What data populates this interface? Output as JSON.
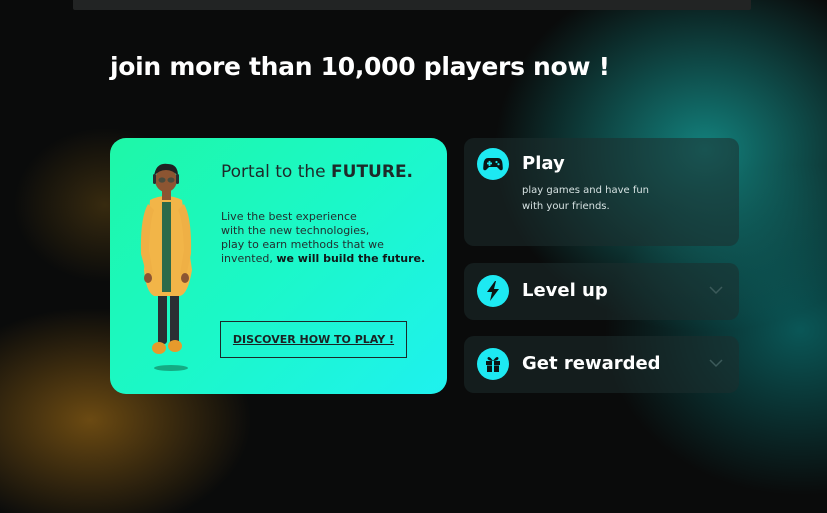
{
  "headline": "join more than 10,000 players now !",
  "promo": {
    "title_prefix": "Portal to the ",
    "title_bold": "FUTURE.",
    "body_lines": [
      "Live the best experience",
      "with the new technologies,",
      "play to earn methods that we",
      "invented, "
    ],
    "body_bold": "we will build the future.",
    "button_label": "DISCOVER HOW TO PLAY !"
  },
  "features": {
    "play": {
      "icon": "gamepad-icon",
      "title": "Play",
      "desc_lines": [
        "play games and have fun",
        "with your friends."
      ]
    },
    "level_up": {
      "icon": "lightning-icon",
      "title": "Level up",
      "chevron": "chevron-down-icon"
    },
    "get_rewarded": {
      "icon": "gift-icon",
      "title": "Get rewarded",
      "chevron": "chevron-down-icon"
    }
  },
  "colors": {
    "accent_cyan": "#1de9f2",
    "promo_gradient_start": "#1ef7a7",
    "promo_gradient_end": "#1ff1ef",
    "background": "#0a0b0b"
  }
}
